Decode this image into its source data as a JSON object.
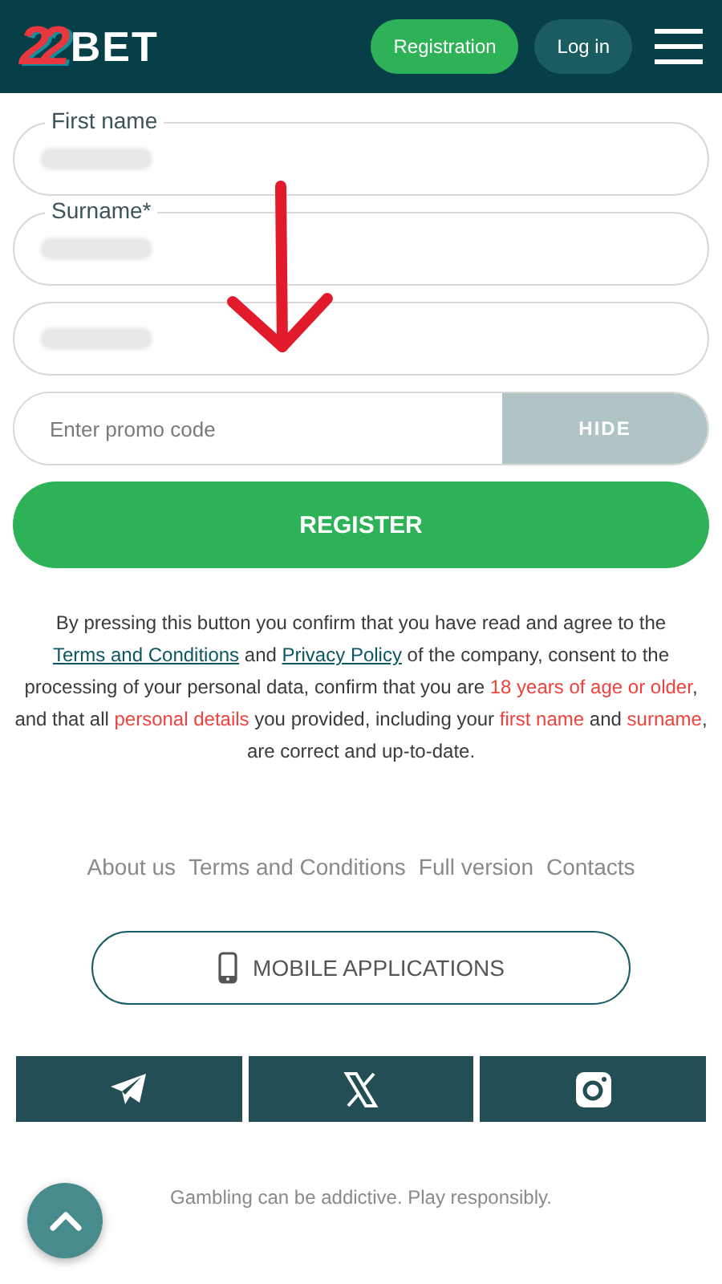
{
  "header": {
    "logo": {
      "digits": "22",
      "word": "BET"
    },
    "buttons": [
      {
        "label": "Registration",
        "kind": "primary"
      },
      {
        "label": "Log in",
        "kind": "secondary"
      }
    ]
  },
  "form": {
    "fields": [
      {
        "label": "First name",
        "redacted": true
      },
      {
        "label": "Surname*",
        "redacted": true
      },
      {
        "redacted": true
      }
    ],
    "promo": {
      "placeholder": "Enter promo code",
      "toggle": "HIDE"
    },
    "submit": "REGISTER"
  },
  "consent": [
    {
      "kind": "text",
      "text": "By pressing this button you confirm that you have read and agree to the "
    },
    {
      "kind": "link",
      "text": "Terms and Conditions"
    },
    {
      "kind": "text",
      "text": " and "
    },
    {
      "kind": "link",
      "text": "Privacy Policy"
    },
    {
      "kind": "text",
      "text": " of the company, consent to the processing of your personal data, confirm that you are "
    },
    {
      "kind": "highlight",
      "text": "18 years of age or older"
    },
    {
      "kind": "text",
      "text": ", and that all "
    },
    {
      "kind": "highlight",
      "text": "personal details"
    },
    {
      "kind": "text",
      "text": " you provided, including your "
    },
    {
      "kind": "highlight",
      "text": "first name"
    },
    {
      "kind": "text",
      "text": " and "
    },
    {
      "kind": "highlight",
      "text": "surname"
    },
    {
      "kind": "text",
      "text": ", are correct and up-to-date."
    }
  ],
  "footer": {
    "links": [
      "About us",
      "Terms and Conditions",
      "Full version",
      "Contacts"
    ],
    "apps_button": "MOBILE APPLICATIONS",
    "socials": [
      {
        "kind": "telegram"
      },
      {
        "kind": "x"
      },
      {
        "kind": "instagram"
      }
    ],
    "notice": "Gambling can be addictive. Play responsibly."
  }
}
